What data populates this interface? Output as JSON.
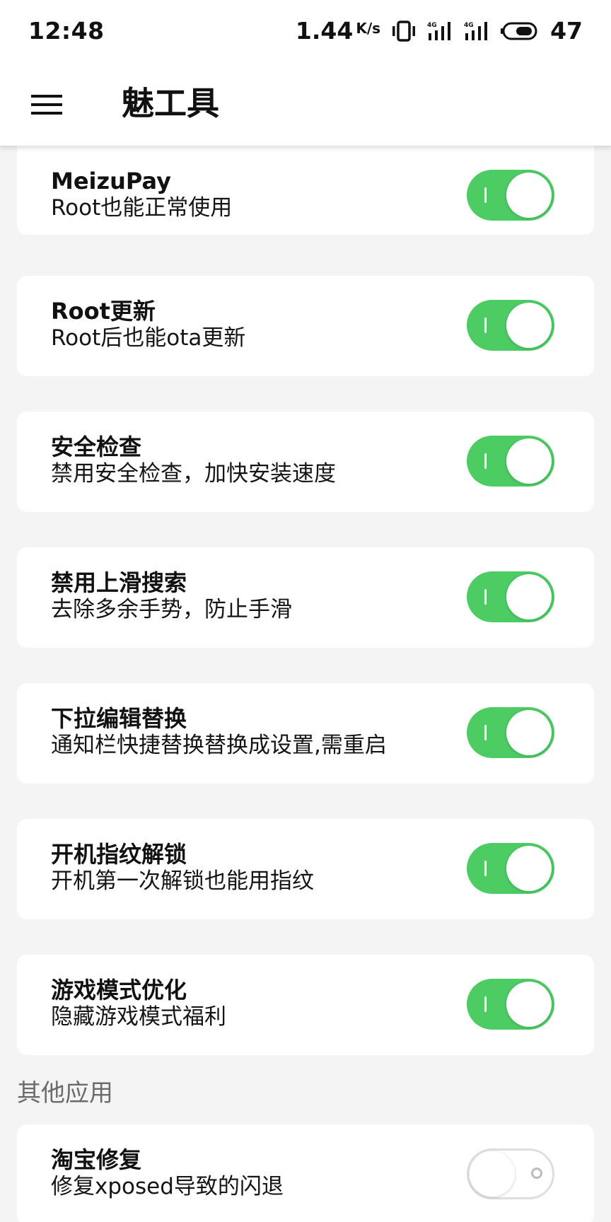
{
  "status_bar": {
    "time": "12:48",
    "net_speed": "1.44",
    "net_unit": "K/s",
    "network_type_1": "4G",
    "network_type_2": "4G",
    "battery_level": "47"
  },
  "app_bar": {
    "menu_icon": "hamburger-menu-icon",
    "title": "魅工具"
  },
  "colors": {
    "toggle_on": "#4ccc63",
    "toggle_off_border": "#dedede",
    "background": "#f4f4f4"
  },
  "cards": [
    {
      "title": "MeizuPay",
      "desc": "Root也能正常使用",
      "enabled": true
    },
    {
      "title": "Root更新",
      "desc": "Root后也能ota更新",
      "enabled": true
    },
    {
      "title": "安全检查",
      "desc": "禁用安全检查，加快安装速度",
      "enabled": true
    },
    {
      "title": "禁用上滑搜索",
      "desc": "去除多余手势，防止手滑",
      "enabled": true
    },
    {
      "title": "下拉编辑替换",
      "desc": "通知栏快捷替换替换成设置,需重启",
      "enabled": true
    },
    {
      "title": "开机指纹解锁",
      "desc": "开机第一次解锁也能用指纹",
      "enabled": true
    },
    {
      "title": "游戏模式优化",
      "desc": "隐藏游戏模式福利",
      "enabled": true
    }
  ],
  "section_other": {
    "header": "其他应用",
    "cards": [
      {
        "title": "淘宝修复",
        "desc": "修复xposed导致的闪退",
        "enabled": false
      }
    ]
  }
}
